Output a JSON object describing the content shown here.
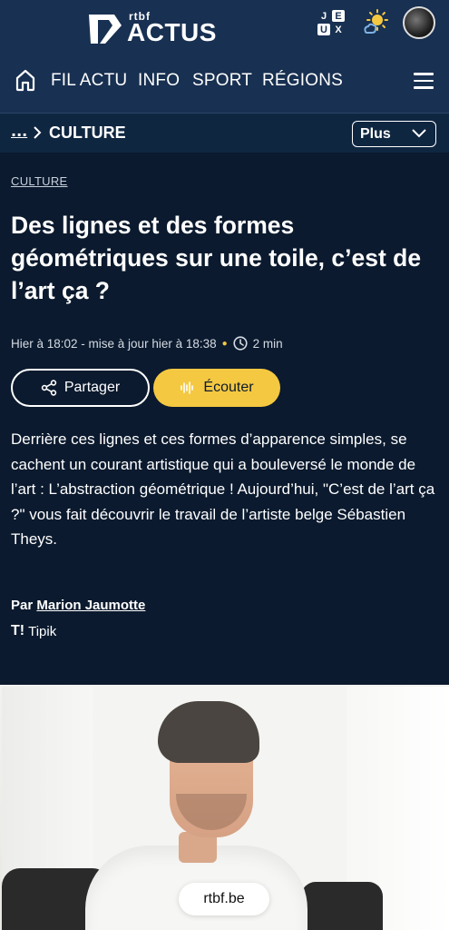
{
  "header": {
    "logo_small": "rtbf",
    "logo_big": "ACTUS",
    "jeux_letters": [
      "J",
      "E",
      "U",
      "X"
    ],
    "nav_items": [
      "FIL ACTU",
      "INFO",
      "SPORT",
      "RÉGIONS"
    ],
    "icons": {
      "home": "home-icon",
      "menu": "hamburger-menu-icon",
      "weather": "sun-cloud-icon",
      "jeux": "jeux-icon"
    }
  },
  "breadcrumb": {
    "ellipsis": "...",
    "current": "CULTURE",
    "plus_label": "Plus"
  },
  "article": {
    "category": "CULTURE",
    "title": "Des lignes et des formes géométriques sur une toile, c’est de l’art ça ?",
    "published": "Hier à 18:02 - mise à jour hier à 18:38",
    "reading_time": "2 min",
    "share_label": "Partager",
    "listen_label": "Écouter",
    "lead": "Derrière ces lignes et ces formes d’apparence simples, se cachent un courant artistique qui a bouleversé le monde de l’art : L’abstraction géométrique ! Aujourd’hui, \"C’est de l’art ça ?\" vous fait découvrir le travail de l’artiste belge Sébastien Theys.",
    "byline_prefix": "Par",
    "author": "Marion Jaumotte",
    "source_logo": "T!",
    "source_name": "Tipik"
  },
  "video": {
    "url_label": "rtbf.be"
  },
  "colors": {
    "header_bg": "#183051",
    "page_bg": "#0b1a2e",
    "accent_yellow": "#f5c842"
  }
}
